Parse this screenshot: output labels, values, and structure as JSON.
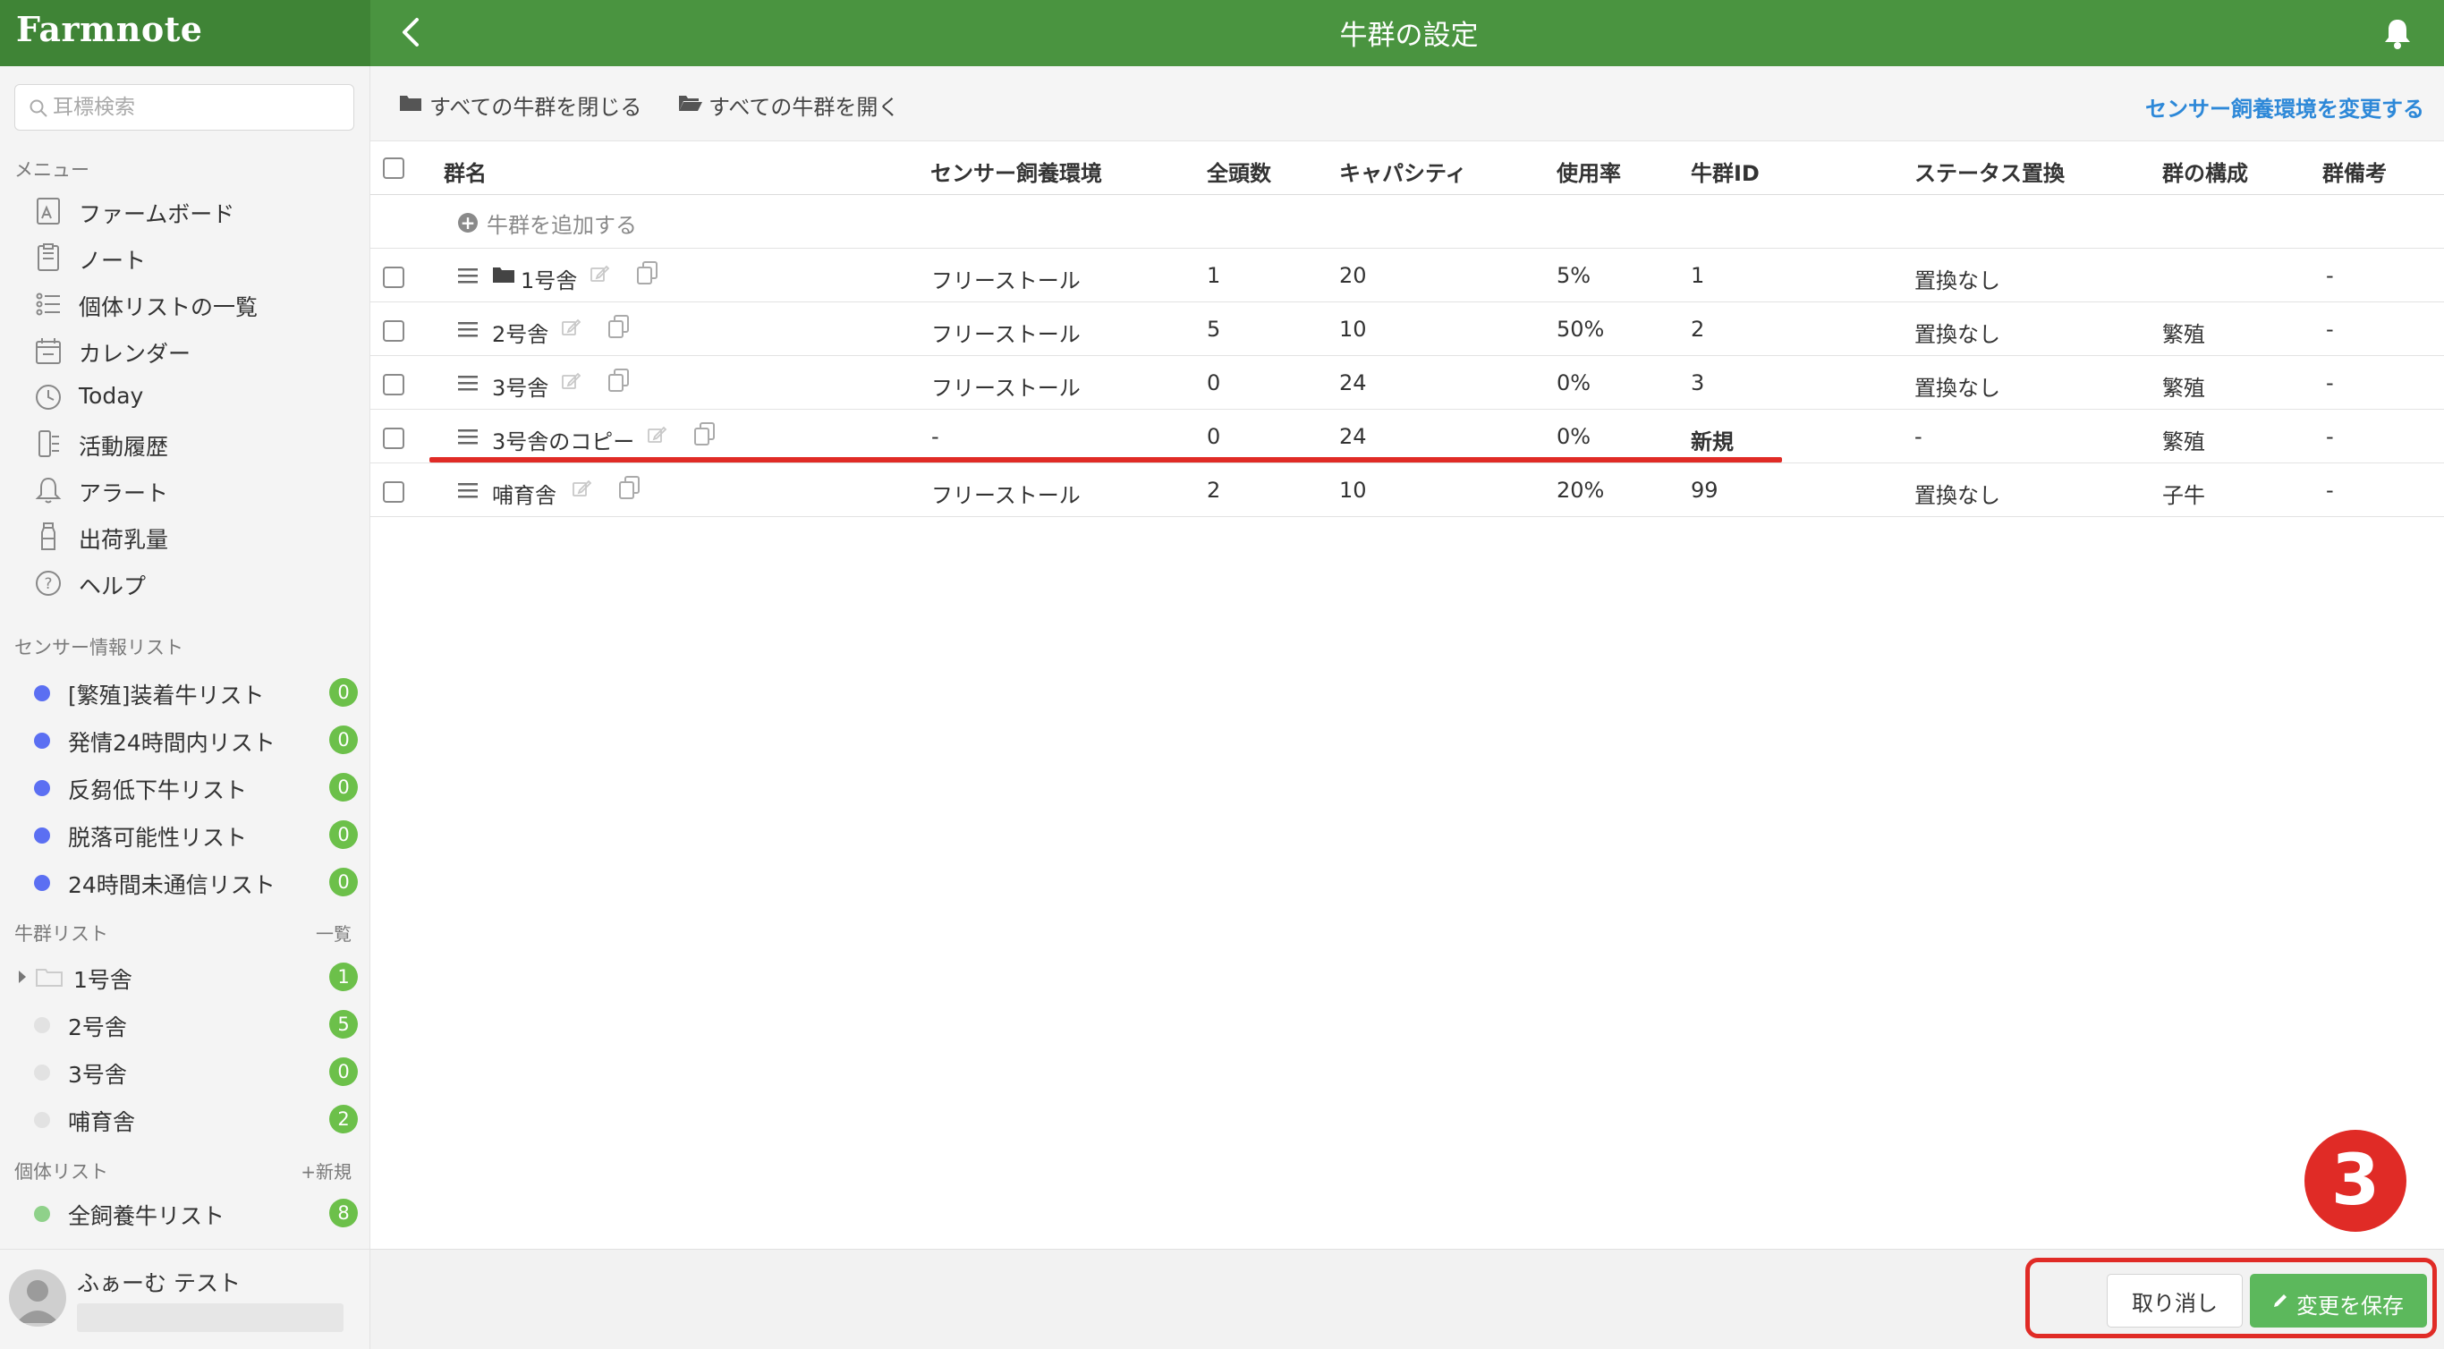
{
  "header": {
    "brand": "Farmnote",
    "title": "牛群の設定"
  },
  "sidebar": {
    "search_placeholder": "耳標検索",
    "menu_label": "メニュー",
    "menu_items": [
      {
        "label": "ファームボード",
        "icon": "farmboard-icon"
      },
      {
        "label": "ノート",
        "icon": "note-icon"
      },
      {
        "label": "個体リストの一覧",
        "icon": "list-icon"
      },
      {
        "label": "カレンダー",
        "icon": "calendar-icon"
      },
      {
        "label": "Today",
        "icon": "clock-icon"
      },
      {
        "label": "活動履歴",
        "icon": "history-icon"
      },
      {
        "label": "アラート",
        "icon": "bell-icon"
      },
      {
        "label": "出荷乳量",
        "icon": "milk-bottle-icon"
      },
      {
        "label": "ヘルプ",
        "icon": "help-icon"
      }
    ],
    "sensor_label": "センサー情報リスト",
    "sensor_items": [
      {
        "label": "[繁殖]装着牛リスト",
        "count": "0"
      },
      {
        "label": "発情24時間内リスト",
        "count": "0"
      },
      {
        "label": "反芻低下牛リスト",
        "count": "0"
      },
      {
        "label": "脱落可能性リスト",
        "count": "0"
      },
      {
        "label": "24時間未通信リスト",
        "count": "0"
      }
    ],
    "herd_label": "牛群リスト",
    "herd_action": "一覧",
    "herd_items": [
      {
        "label": "1号舎",
        "count": "1"
      },
      {
        "label": "2号舎",
        "count": "5"
      },
      {
        "label": "3号舎",
        "count": "0"
      },
      {
        "label": "哺育舎",
        "count": "2"
      }
    ],
    "individual_label": "個体リスト",
    "individual_action": "+新規",
    "individual_items": [
      {
        "label": "全飼養牛リスト",
        "count": "8"
      }
    ],
    "user_name": "ふぁーむ テスト"
  },
  "toolbar": {
    "close_all": "すべての牛群を閉じる",
    "open_all": "すべての牛群を開く",
    "change_sensor": "センサー飼養環境を変更する"
  },
  "table": {
    "headers": {
      "name": "群名",
      "sensor": "センサー飼養環境",
      "total": "全頭数",
      "capacity": "キャパシティ",
      "usage": "使用率",
      "herd_id": "牛群ID",
      "status": "ステータス置換",
      "composition": "群の構成",
      "remarks": "群備考"
    },
    "add_label": "牛群を追加する",
    "rows": [
      {
        "name": "1号舎",
        "sensor": "フリーストール",
        "total": "1",
        "capacity": "20",
        "usage": "5%",
        "herd_id": "1",
        "status": "置換なし",
        "composition": "",
        "remarks": "-"
      },
      {
        "name": "2号舎",
        "sensor": "フリーストール",
        "total": "5",
        "capacity": "10",
        "usage": "50%",
        "herd_id": "2",
        "status": "置換なし",
        "composition": "繁殖",
        "remarks": "-"
      },
      {
        "name": "3号舎",
        "sensor": "フリーストール",
        "total": "0",
        "capacity": "24",
        "usage": "0%",
        "herd_id": "3",
        "status": "置換なし",
        "composition": "繁殖",
        "remarks": "-"
      },
      {
        "name": "3号舎のコピー",
        "sensor": "-",
        "total": "0",
        "capacity": "24",
        "usage": "0%",
        "herd_id": "新規",
        "status": "-",
        "composition": "繁殖",
        "remarks": "-"
      },
      {
        "name": "哺育舎",
        "sensor": "フリーストール",
        "total": "2",
        "capacity": "10",
        "usage": "20%",
        "herd_id": "99",
        "status": "置換なし",
        "composition": "子牛",
        "remarks": "-"
      }
    ]
  },
  "footer": {
    "cancel": "取り消し",
    "save": "変更を保存"
  },
  "annotation": {
    "step_number": "3"
  },
  "colors": {
    "header_green": "#4a9440",
    "count_badge_green": "#6cc04a",
    "sensor_dot_blue": "#5b6ff2",
    "save_green": "#5cb85c",
    "annotation_red": "#e02b26",
    "link_blue": "#2d88d8"
  }
}
